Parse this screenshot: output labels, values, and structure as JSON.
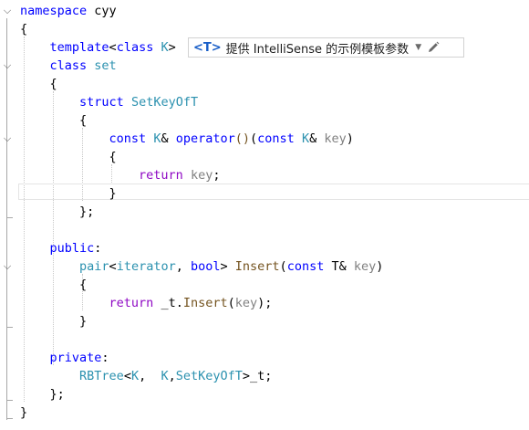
{
  "editor": {
    "lines": [
      [
        {
          "t": "namespace",
          "c": "kw"
        },
        {
          "t": " cyy",
          "c": "pl"
        }
      ],
      [
        {
          "t": "{",
          "c": "pl"
        }
      ],
      [
        {
          "t": "    ",
          "c": "pl"
        },
        {
          "t": "template",
          "c": "kw"
        },
        {
          "t": "<",
          "c": "pl"
        },
        {
          "t": "class",
          "c": "kw"
        },
        {
          "t": " ",
          "c": "pl"
        },
        {
          "t": "K",
          "c": "ty"
        },
        {
          "t": ">",
          "c": "pl"
        }
      ],
      [
        {
          "t": "    ",
          "c": "pl"
        },
        {
          "t": "class",
          "c": "kw"
        },
        {
          "t": " ",
          "c": "pl"
        },
        {
          "t": "set",
          "c": "ty"
        }
      ],
      [
        {
          "t": "    {",
          "c": "pl"
        }
      ],
      [
        {
          "t": "        ",
          "c": "pl"
        },
        {
          "t": "struct",
          "c": "kw"
        },
        {
          "t": " ",
          "c": "pl"
        },
        {
          "t": "SetKeyOfT",
          "c": "ty"
        }
      ],
      [
        {
          "t": "        {",
          "c": "pl"
        }
      ],
      [
        {
          "t": "            ",
          "c": "pl"
        },
        {
          "t": "const",
          "c": "kw"
        },
        {
          "t": " ",
          "c": "pl"
        },
        {
          "t": "K",
          "c": "ty"
        },
        {
          "t": "& ",
          "c": "pl"
        },
        {
          "t": "operator",
          "c": "kw"
        },
        {
          "t": "()",
          "c": "fn"
        },
        {
          "t": "(",
          "c": "pl"
        },
        {
          "t": "const",
          "c": "kw"
        },
        {
          "t": " ",
          "c": "pl"
        },
        {
          "t": "K",
          "c": "ty"
        },
        {
          "t": "& ",
          "c": "pl"
        },
        {
          "t": "key",
          "c": "par"
        },
        {
          "t": ")",
          "c": "pl"
        }
      ],
      [
        {
          "t": "            {",
          "c": "pl"
        }
      ],
      [
        {
          "t": "                ",
          "c": "pl"
        },
        {
          "t": "return",
          "c": "ctl"
        },
        {
          "t": " ",
          "c": "pl"
        },
        {
          "t": "key",
          "c": "par"
        },
        {
          "t": ";",
          "c": "pl"
        }
      ],
      [
        {
          "t": "            }",
          "c": "pl"
        }
      ],
      [
        {
          "t": "        };",
          "c": "pl"
        }
      ],
      [],
      [
        {
          "t": "    ",
          "c": "pl"
        },
        {
          "t": "public",
          "c": "kw"
        },
        {
          "t": ":",
          "c": "pl"
        }
      ],
      [
        {
          "t": "        ",
          "c": "pl"
        },
        {
          "t": "pair",
          "c": "ty"
        },
        {
          "t": "<",
          "c": "pl"
        },
        {
          "t": "iterator",
          "c": "ty"
        },
        {
          "t": ", ",
          "c": "pl"
        },
        {
          "t": "bool",
          "c": "kw"
        },
        {
          "t": "> ",
          "c": "pl"
        },
        {
          "t": "Insert",
          "c": "fn"
        },
        {
          "t": "(",
          "c": "pl"
        },
        {
          "t": "const",
          "c": "kw"
        },
        {
          "t": " T& ",
          "c": "pl"
        },
        {
          "t": "key",
          "c": "par"
        },
        {
          "t": ")",
          "c": "pl"
        }
      ],
      [
        {
          "t": "        {",
          "c": "pl"
        }
      ],
      [
        {
          "t": "            ",
          "c": "pl"
        },
        {
          "t": "return",
          "c": "ctl"
        },
        {
          "t": " _t.",
          "c": "pl"
        },
        {
          "t": "Insert",
          "c": "fn"
        },
        {
          "t": "(",
          "c": "pl"
        },
        {
          "t": "key",
          "c": "par"
        },
        {
          "t": ");",
          "c": "pl"
        }
      ],
      [
        {
          "t": "        }",
          "c": "pl"
        }
      ],
      [],
      [
        {
          "t": "    ",
          "c": "pl"
        },
        {
          "t": "private",
          "c": "kw"
        },
        {
          "t": ":",
          "c": "pl"
        }
      ],
      [
        {
          "t": "        ",
          "c": "pl"
        },
        {
          "t": "RBTree",
          "c": "ty"
        },
        {
          "t": "<",
          "c": "pl"
        },
        {
          "t": "K",
          "c": "ty"
        },
        {
          "t": ",  ",
          "c": "pl"
        },
        {
          "t": "K",
          "c": "ty"
        },
        {
          "t": ",",
          "c": "pl"
        },
        {
          "t": "SetKeyOfT",
          "c": "ty"
        },
        {
          "t": ">_t;",
          "c": "pl"
        }
      ],
      [
        {
          "t": "    };",
          "c": "pl"
        }
      ],
      [
        {
          "t": "}",
          "c": "pl"
        }
      ]
    ],
    "fold_markers": [
      0,
      3,
      7,
      14
    ]
  },
  "intellisense_hint": {
    "tag": "<T>",
    "text": "提供 IntelliSense 的示例模板参数",
    "dropdown_icon": "chevron-down-icon",
    "edit_icon": "pencil-icon"
  },
  "colors": {
    "keyword": "#0000ff",
    "type": "#2b91af",
    "control": "#8f08c4",
    "function": "#74531f",
    "parameter": "#808080",
    "hint_tag": "#1a5fc8"
  }
}
